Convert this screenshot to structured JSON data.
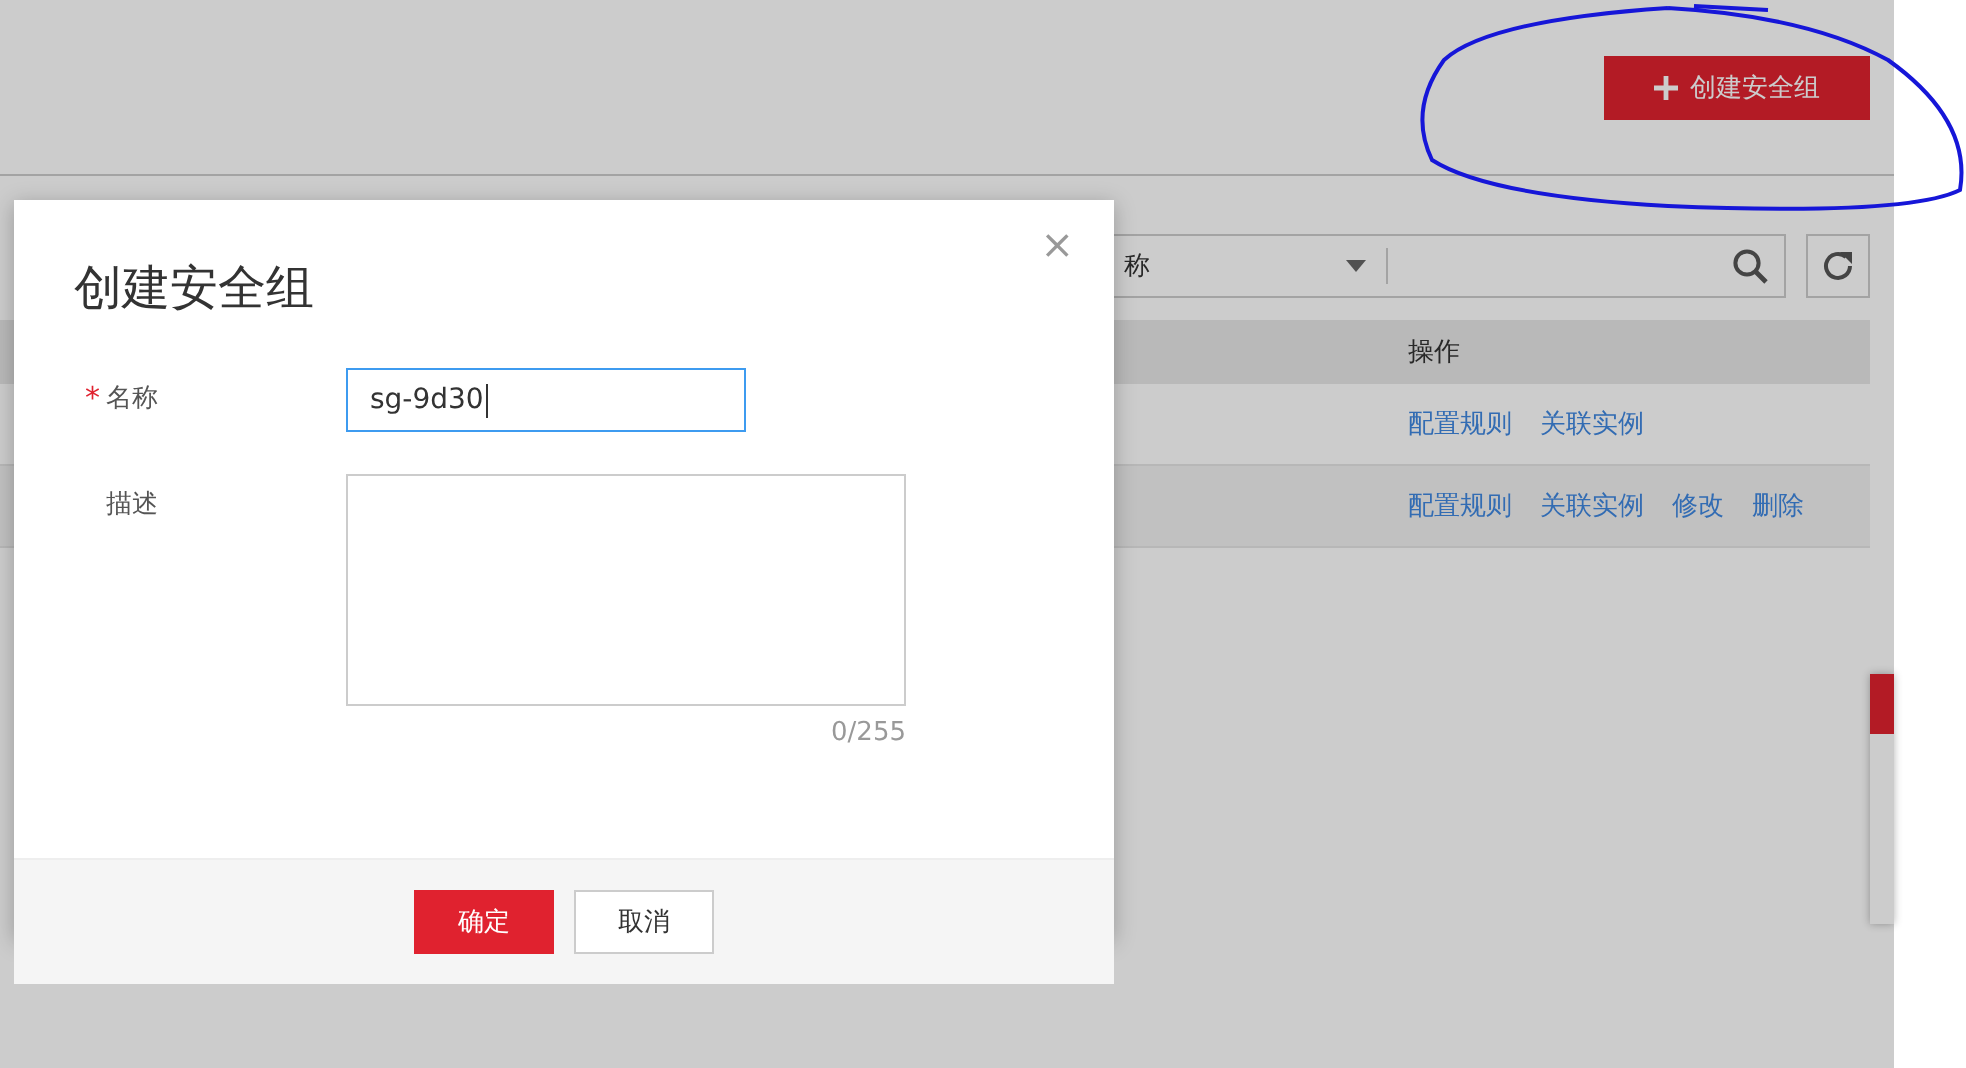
{
  "page": {
    "create_button": {
      "label": "创建安全组"
    },
    "filter": {
      "field_text": "称"
    },
    "table": {
      "columns": [
        {
          "label": "操作"
        }
      ],
      "rows": [
        {
          "actions": [
            "配置规则",
            "关联实例"
          ]
        },
        {
          "actions": [
            "配置规则",
            "关联实例",
            "修改",
            "删除"
          ]
        }
      ]
    }
  },
  "dialog": {
    "title": "创建安全组",
    "close": "×",
    "fields": [
      {
        "kind": "input",
        "label": "名称",
        "required_mark": "*",
        "focused": true,
        "value": "sg-9d30"
      },
      {
        "kind": "textarea",
        "label": "描述",
        "focused": false,
        "counter": "0/255"
      }
    ],
    "buttons": [
      {
        "kind": "primary",
        "label": "确定"
      },
      {
        "kind": "secondary",
        "label": "取消"
      }
    ]
  }
}
